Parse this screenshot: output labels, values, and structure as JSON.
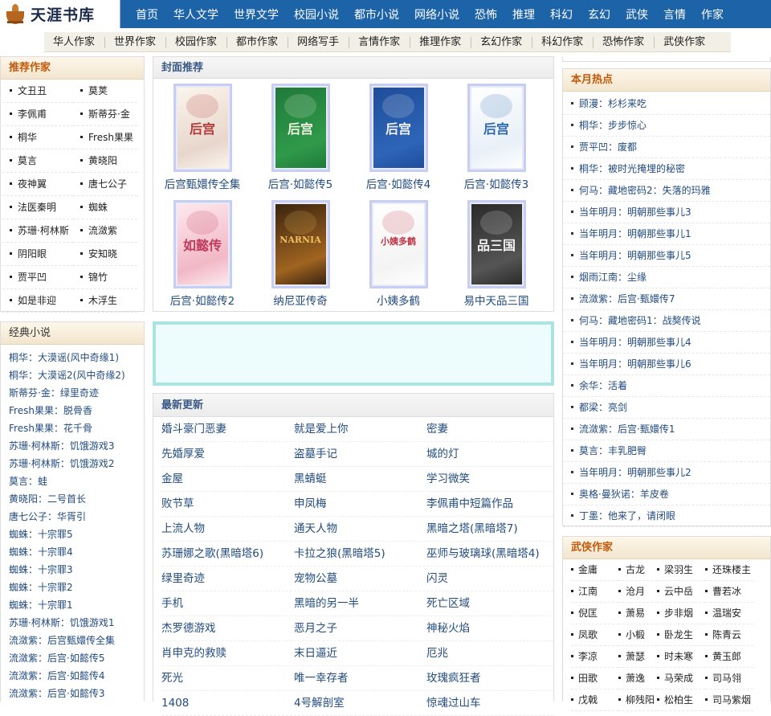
{
  "site": {
    "logo_text": "天涯书库",
    "logo_icon": "teapot-logo-icon"
  },
  "main_nav": [
    "首页",
    "华人文学",
    "世界文学",
    "校园小说",
    "都市小说",
    "网络小说",
    "恐怖",
    "推理",
    "科幻",
    "玄幻",
    "武侠",
    "言情",
    "作家"
  ],
  "sub_nav": [
    "华人作家",
    "世界作家",
    "校园作家",
    "都市作家",
    "网络写手",
    "言情作家",
    "推理作家",
    "玄幻作家",
    "科幻作家",
    "恐怖作家",
    "武侠作家"
  ],
  "recommended_authors": {
    "title": "推荐作家",
    "items": [
      "文丑丑",
      "莫荚",
      "李佩甫",
      "斯蒂芬·金",
      "桐华",
      "Fresh果果",
      "莫言",
      "黄晓阳",
      "夜神翼",
      "唐七公子",
      "法医秦明",
      "蜘蛛",
      "苏珊·柯林斯",
      "流潋紫",
      "阴阳眼",
      "安知晓",
      "贾平凹",
      "锦竹",
      "如是非迎",
      "木浮生"
    ]
  },
  "classic_novels": {
    "title": "经典小说",
    "items": [
      "桐华：大漠谣(风中奇缘1)",
      "桐华：大漠谣2(风中奇缘2)",
      "斯蒂芬·金：绿里奇迹",
      "Fresh果果：脱骨香",
      "Fresh果果：花千骨",
      "苏珊·柯林斯：饥饿游戏3",
      "苏珊·柯林斯：饥饿游戏2",
      "莫言：蛙",
      "黄晓阳：二号首长",
      "唐七公子：华胥引",
      "蜘蛛：十宗罪5",
      "蜘蛛：十宗罪4",
      "蜘蛛：十宗罪3",
      "蜘蛛：十宗罪2",
      "蜘蛛：十宗罪1",
      "苏珊·柯林斯：饥饿游戏1",
      "流潋紫：后宫甄嬛传全集",
      "流潋紫：后宫·如懿传5",
      "流潋紫：后宫·如懿传4",
      "流潋紫：后宫·如懿传3"
    ]
  },
  "cover_recommend": {
    "title": "封面推荐",
    "books": [
      {
        "title": "后宫甄嬛传全集",
        "cover_text": "后宫",
        "palette": [
          "#fbf5ec",
          "#e8d6cc",
          "#b23a3a"
        ]
      },
      {
        "title": "后宫·如懿传5",
        "cover_text": "后宫",
        "palette": [
          "#1f7a3a",
          "#2f9a4a",
          "#f1f1e0"
        ]
      },
      {
        "title": "后宫·如懿传4",
        "cover_text": "后宫",
        "palette": [
          "#1e4d9a",
          "#2e65b8",
          "#f0f0f0"
        ]
      },
      {
        "title": "后宫·如懿传3",
        "cover_text": "后宫",
        "palette": [
          "#ffffff",
          "#e8f0f8",
          "#2e69b0"
        ]
      },
      {
        "title": "后宫·如懿传2",
        "cover_text": "如懿传",
        "palette": [
          "#fde8ee",
          "#f2b8c6",
          "#c03a5a"
        ]
      },
      {
        "title": "纳尼亚传奇",
        "cover_text": "NARNIA",
        "palette": [
          "#3b2410",
          "#a06420",
          "#f0c060"
        ]
      },
      {
        "title": "小姨多鹤",
        "cover_text": "小姨多鹤",
        "palette": [
          "#ffffff",
          "#f4f4f4",
          "#c03040"
        ]
      },
      {
        "title": "易中天品三国",
        "cover_text": "品三国",
        "palette": [
          "#2a2a2a",
          "#555555",
          "#f2f2f2"
        ]
      }
    ]
  },
  "latest_updates": {
    "title": "最新更新",
    "rows": [
      [
        "婚斗豪门恶妻",
        "就是爱上你",
        "密妻"
      ],
      [
        "先婚厚爱",
        "盗墓手记",
        "城的灯"
      ],
      [
        "金屋",
        "黑蜻蜓",
        "学习微笑"
      ],
      [
        "败节草",
        "申凤梅",
        "李佩甫中短篇作品"
      ],
      [
        "上流人物",
        "通天人物",
        "黑暗之塔(黑暗塔7)"
      ],
      [
        "苏珊娜之歌(黑暗塔6)",
        "卡拉之狼(黑暗塔5)",
        "巫师与玻璃球(黑暗塔4)"
      ],
      [
        "绿里奇迹",
        "宠物公墓",
        "闪灵"
      ],
      [
        "手机",
        "黑暗的另一半",
        "死亡区域"
      ],
      [
        "杰罗德游戏",
        "恶月之子",
        "神秘火焰"
      ],
      [
        "肖申克的救赎",
        "末日逼近",
        "厄兆"
      ],
      [
        "死光",
        "唯一幸存者",
        "玫瑰疯狂者"
      ],
      [
        "1408",
        "4号解剖室",
        "惊魂过山车"
      ]
    ]
  },
  "monthly_hot": {
    "title": "本月热点",
    "items": [
      "顾漫：杉杉来吃",
      "桐华：步步惊心",
      "贾平凹：废都",
      "桐华：被时光掩埋的秘密",
      "何马：藏地密码2：失落的玛雅",
      "当年明月：明朝那些事儿3",
      "当年明月：明朝那些事儿1",
      "当年明月：明朝那些事儿5",
      "烟雨江南：尘缘",
      "流潋紫：后宫·甄嬛传7",
      "何马：藏地密码1：战獒传说",
      "当年明月：明朝那些事儿4",
      "当年明月：明朝那些事儿6",
      "余华：活着",
      "都梁：亮剑",
      "流潋紫：后宫·甄嬛传1",
      "莫言：丰乳肥臀",
      "当年明月：明朝那些事儿2",
      "奥格·曼狄诺：羊皮卷",
      "丁墨：他来了，请闭眼"
    ]
  },
  "wuxia_authors": {
    "title": "武侠作家",
    "items": [
      "金庸",
      "古龙",
      "梁羽生",
      "还珠楼主",
      "江南",
      "沧月",
      "云中岳",
      "曹若冰",
      "倪匡",
      "萧易",
      "步非烟",
      "温瑞安",
      "凤歌",
      "小椴",
      "卧龙生",
      "陈青云",
      "李凉",
      "萧瑟",
      "时未寒",
      "黄玉郎",
      "田歌",
      "萧逸",
      "马荣成",
      "司马翎",
      "戊戟",
      "柳残阳",
      "松柏生",
      "司马紫烟"
    ]
  },
  "colors": {
    "header_blue": "#1d63a8",
    "link_blue": "#224b7e",
    "section_orange": "#c15a0a",
    "ad_cyan": "#a9e4e1"
  }
}
